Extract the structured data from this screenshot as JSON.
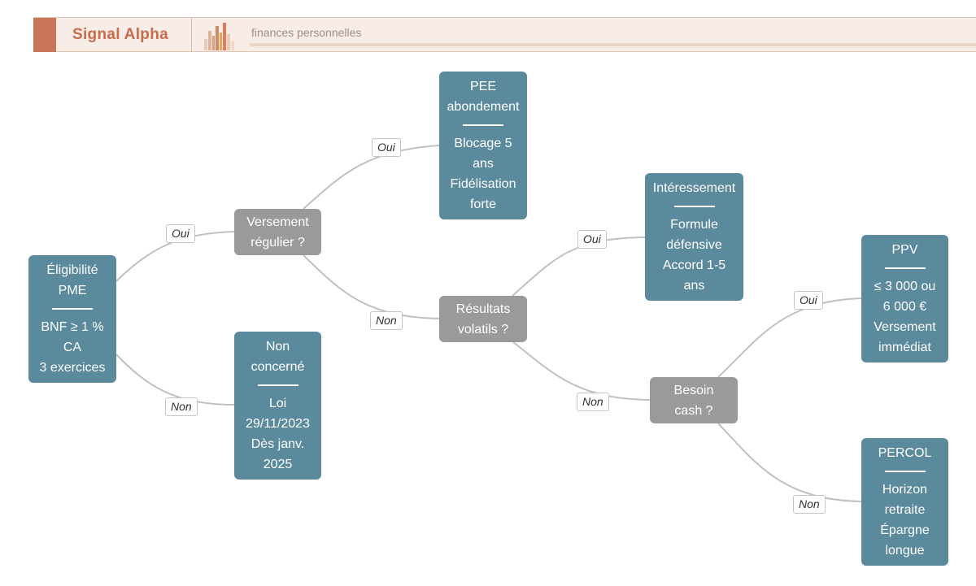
{
  "header": {
    "brand": "Signal Alpha",
    "tagline": "finances personnelles"
  },
  "colors": {
    "leaf": "#5a8a9c",
    "decision": "#999a9c",
    "accent": "#c97558",
    "edge": "#c0c0c4"
  },
  "nodes": {
    "eligibilite": {
      "title": [
        "Éligibilité",
        "PME"
      ],
      "body": [
        "BNF ≥ 1 %",
        "CA",
        "3 exercices"
      ]
    },
    "versement": {
      "lines": [
        "Versement",
        "régulier ?"
      ]
    },
    "non_concerne": {
      "title": [
        "Non",
        "concerné"
      ],
      "body": [
        "Loi",
        "29/11/2023",
        "Dès janv.",
        "2025"
      ]
    },
    "pee": {
      "title": [
        "PEE",
        "abondement"
      ],
      "body": [
        "Blocage 5",
        "ans",
        "Fidélisation",
        "forte"
      ]
    },
    "resultats": {
      "lines": [
        "Résultats",
        "volatils ?"
      ]
    },
    "interessement": {
      "title": [
        "Intéressement"
      ],
      "body": [
        "Formule",
        "défensive",
        "Accord 1-5",
        "ans"
      ]
    },
    "besoin": {
      "lines": [
        "Besoin",
        "cash ?"
      ]
    },
    "ppv": {
      "title": [
        "PPV"
      ],
      "body": [
        "≤ 3 000 ou",
        "6 000 €",
        "Versement",
        "immédiat"
      ]
    },
    "percol": {
      "title": [
        "PERCOL"
      ],
      "body": [
        "Horizon",
        "retraite",
        "Épargne",
        "longue"
      ]
    }
  },
  "edge_labels": {
    "e1": "Oui",
    "e2": "Non",
    "e3": "Oui",
    "e4": "Non",
    "e5": "Oui",
    "e6": "Non",
    "e7": "Oui",
    "e8": "Non"
  }
}
